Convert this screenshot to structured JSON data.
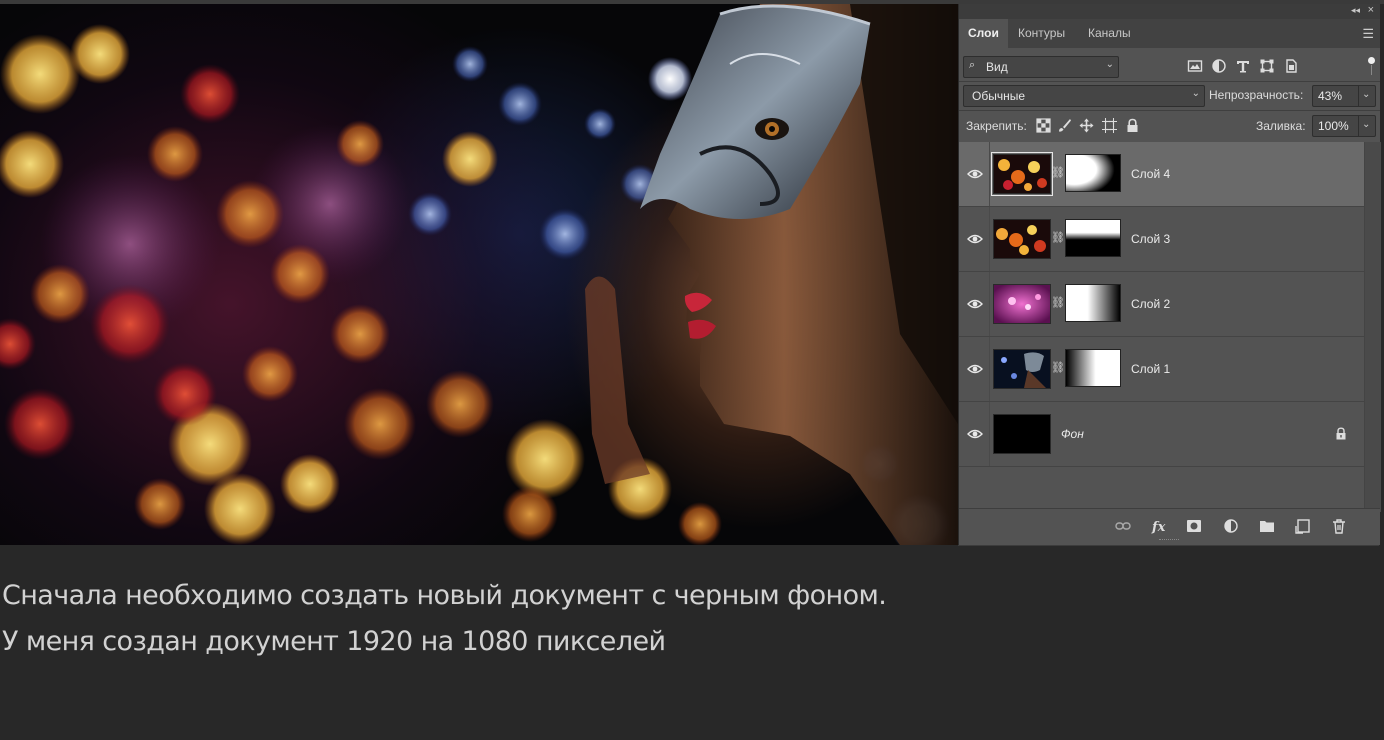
{
  "tabs": [
    {
      "label": "Слои",
      "active": true
    },
    {
      "label": "Контуры",
      "active": false
    },
    {
      "label": "Каналы",
      "active": false
    }
  ],
  "filter": {
    "label": "Вид"
  },
  "blend": {
    "mode": "Обычные",
    "opacity_label": "Непрозрачность:",
    "opacity_value": "43%"
  },
  "lock": {
    "label": "Закрепить:",
    "fill_label": "Заливка:",
    "fill_value": "100%"
  },
  "layers": [
    {
      "name": "Слой 4",
      "selected": true,
      "visible": true
    },
    {
      "name": "Слой 3",
      "selected": false,
      "visible": true
    },
    {
      "name": "Слой 2",
      "selected": false,
      "visible": true
    },
    {
      "name": "Слой 1",
      "selected": false,
      "visible": true
    },
    {
      "name": "Фон",
      "selected": false,
      "visible": true,
      "locked": true
    }
  ],
  "caption": {
    "line1": "Сначала необходимо создать новый документ с черным фоном.",
    "line2": "У меня создан документ 1920 на 1080 пикселей"
  },
  "icons": {
    "collapse": "double-chevron-left-icon",
    "close": "close-icon",
    "panel_menu": "hamburger-menu-icon",
    "link": "link-icon",
    "fx": "fx-icon",
    "mask": "add-mask-icon",
    "adjustment": "adjustment-layer-icon",
    "group": "folder-icon",
    "new_layer": "new-layer-icon",
    "delete": "trash-icon"
  },
  "colors": {
    "panel_bg": "#535353",
    "selected_layer": "#6a6a6a",
    "page_bg": "#282828"
  }
}
